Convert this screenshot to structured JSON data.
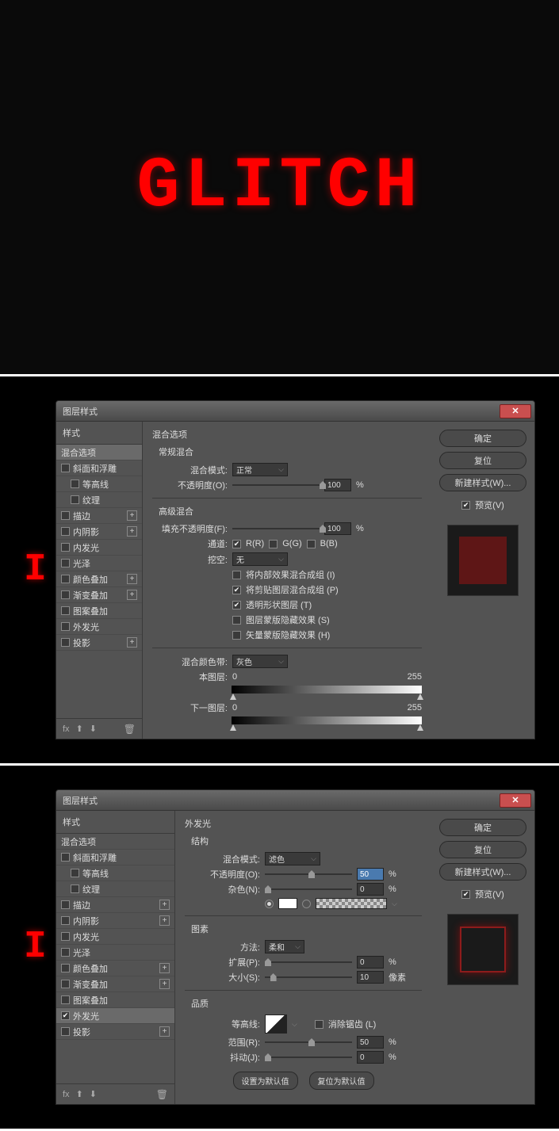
{
  "canvas": {
    "text": "GLITCH",
    "peek": "I"
  },
  "dialog1": {
    "title": "图层样式",
    "styles_header": "样式",
    "styles": [
      {
        "label": "混合选项",
        "selected": true,
        "nocb": true
      },
      {
        "label": "斜面和浮雕",
        "plus": false
      },
      {
        "label": "等高线",
        "indent": true
      },
      {
        "label": "纹理",
        "indent": true
      },
      {
        "label": "描边",
        "plus": true
      },
      {
        "label": "内阴影",
        "plus": true
      },
      {
        "label": "内发光"
      },
      {
        "label": "光泽"
      },
      {
        "label": "颜色叠加",
        "plus": true
      },
      {
        "label": "渐变叠加",
        "plus": true
      },
      {
        "label": "图案叠加"
      },
      {
        "label": "外发光"
      },
      {
        "label": "投影",
        "plus": true
      }
    ],
    "section": "混合选项",
    "sub_general": "常规混合",
    "blend_mode_label": "混合模式:",
    "blend_mode_value": "正常",
    "opacity_label": "不透明度(O):",
    "opacity_value": "100",
    "sub_advanced": "高级混合",
    "fill_opacity_label": "填充不透明度(F):",
    "fill_opacity_value": "100",
    "channels_label": "通道:",
    "ch_r": "R(R)",
    "ch_g": "G(G)",
    "ch_b": "B(B)",
    "knockout_label": "挖空:",
    "knockout_value": "无",
    "opt1": "将内部效果混合成组 (I)",
    "opt2": "将剪贴图层混合成组 (P)",
    "opt3": "透明形状图层 (T)",
    "opt4": "图层蒙版隐藏效果 (S)",
    "opt5": "矢量蒙版隐藏效果 (H)",
    "blendif_label": "混合颜色带:",
    "blendif_value": "灰色",
    "this_layer": "本图层:",
    "under_layer": "下一图层:",
    "range_min": "0",
    "range_max": "255",
    "buttons": {
      "ok": "确定",
      "cancel": "复位",
      "new_style": "新建样式(W)...",
      "preview": "预览(V)"
    },
    "percent": "%",
    "fx_label": "fx"
  },
  "dialog2": {
    "title": "图层样式",
    "styles_header": "样式",
    "styles": [
      {
        "label": "混合选项",
        "nocb": true
      },
      {
        "label": "斜面和浮雕"
      },
      {
        "label": "等高线",
        "indent": true
      },
      {
        "label": "纹理",
        "indent": true
      },
      {
        "label": "描边",
        "plus": true
      },
      {
        "label": "内阴影",
        "plus": true
      },
      {
        "label": "内发光"
      },
      {
        "label": "光泽"
      },
      {
        "label": "颜色叠加",
        "plus": true
      },
      {
        "label": "渐变叠加",
        "plus": true
      },
      {
        "label": "图案叠加"
      },
      {
        "label": "外发光",
        "checked": true,
        "selected": true
      },
      {
        "label": "投影",
        "plus": true
      }
    ],
    "section": "外发光",
    "sub_structure": "结构",
    "blend_mode_label": "混合模式:",
    "blend_mode_value": "滤色",
    "opacity_label": "不透明度(O):",
    "opacity_value": "50",
    "noise_label": "杂色(N):",
    "noise_value": "0",
    "sub_elements": "图素",
    "technique_label": "方法:",
    "technique_value": "柔和",
    "spread_label": "扩展(P):",
    "spread_value": "0",
    "size_label": "大小(S):",
    "size_value": "10",
    "px": "像素",
    "sub_quality": "品质",
    "contour_label": "等高线:",
    "antialias_label": "消除锯齿 (L)",
    "range_label": "范围(R):",
    "range_value": "50",
    "jitter_label": "抖动(J):",
    "jitter_value": "0",
    "make_default": "设置为默认值",
    "reset_default": "复位为默认值",
    "buttons": {
      "ok": "确定",
      "cancel": "复位",
      "new_style": "新建样式(W)...",
      "preview": "预览(V)"
    },
    "percent": "%",
    "fx_label": "fx"
  }
}
